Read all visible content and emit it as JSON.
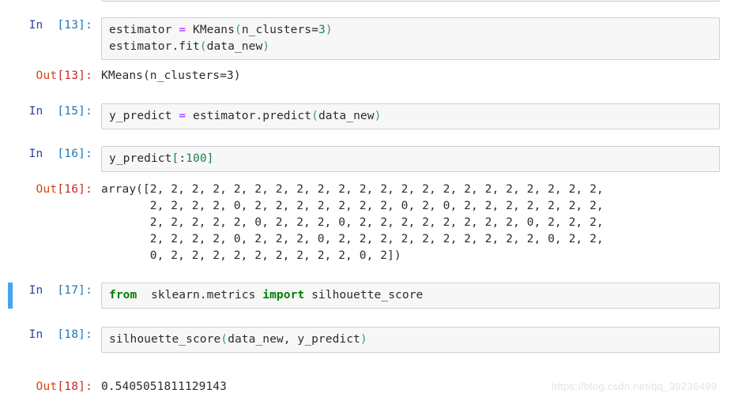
{
  "notebook": {
    "cells": [
      {
        "name": "cell-13",
        "prompt_label": "In",
        "prompt_index": "[13]:",
        "type": "input",
        "selected": false,
        "lines": [
          [
            {
              "t": "estimator ",
              "c": "plain"
            },
            {
              "t": "=",
              "c": "op"
            },
            {
              "t": " KMeans",
              "c": "plain"
            },
            {
              "t": "(",
              "c": "paren"
            },
            {
              "t": "n_clusters",
              "c": "plain"
            },
            {
              "t": "=",
              "c": "plain"
            },
            {
              "t": "3",
              "c": "num"
            },
            {
              "t": ")",
              "c": "paren"
            }
          ],
          [
            {
              "t": "estimator.fit",
              "c": "plain"
            },
            {
              "t": "(",
              "c": "paren"
            },
            {
              "t": "data_new",
              "c": "plain"
            },
            {
              "t": ")",
              "c": "paren"
            }
          ]
        ]
      },
      {
        "name": "cell-out-13",
        "prompt_label": "Out",
        "prompt_index": "[13]:",
        "type": "output",
        "selected": false,
        "lines": [
          [
            {
              "t": "KMeans(n_clusters=3)",
              "c": "outtext"
            }
          ]
        ]
      },
      {
        "name": "cell-15",
        "prompt_label": "In",
        "prompt_index": "[15]:",
        "type": "input",
        "selected": false,
        "lines": [
          [
            {
              "t": "y_predict ",
              "c": "plain"
            },
            {
              "t": "=",
              "c": "op"
            },
            {
              "t": " estimator.predict",
              "c": "plain"
            },
            {
              "t": "(",
              "c": "paren"
            },
            {
              "t": "data_new",
              "c": "plain"
            },
            {
              "t": ")",
              "c": "paren"
            }
          ]
        ]
      },
      {
        "name": "cell-16",
        "prompt_label": "In",
        "prompt_index": "[16]:",
        "type": "input",
        "selected": false,
        "lines": [
          [
            {
              "t": "y_predict",
              "c": "plain"
            },
            {
              "t": "[",
              "c": "brk"
            },
            {
              "t": ":",
              "c": "plain"
            },
            {
              "t": "100",
              "c": "num"
            },
            {
              "t": "]",
              "c": "brk"
            }
          ]
        ]
      },
      {
        "name": "cell-out-16",
        "prompt_label": "Out",
        "prompt_index": "[16]:",
        "type": "output",
        "selected": false,
        "lines": [
          [
            {
              "t": "array([2, 2, 2, 2, 2, 2, 2, 2, 2, 2, 2, 2, 2, 2, 2, 2, 2, 2, 2, 2, 2, 2,",
              "c": "outtext"
            }
          ],
          [
            {
              "t": "       2, 2, 2, 2, 0, 2, 2, 2, 2, 2, 2, 2, 0, 2, 0, 2, 2, 2, 2, 2, 2, 2,",
              "c": "outtext"
            }
          ],
          [
            {
              "t": "       2, 2, 2, 2, 2, 0, 2, 2, 2, 0, 2, 2, 2, 2, 2, 2, 2, 2, 0, 2, 2, 2,",
              "c": "outtext"
            }
          ],
          [
            {
              "t": "       2, 2, 2, 2, 0, 2, 2, 2, 0, 2, 2, 2, 2, 2, 2, 2, 2, 2, 2, 0, 2, 2,",
              "c": "outtext"
            }
          ],
          [
            {
              "t": "       0, 2, 2, 2, 2, 2, 2, 2, 2, 2, 0, 2])",
              "c": "outtext"
            }
          ]
        ]
      },
      {
        "name": "cell-17",
        "prompt_label": "In",
        "prompt_index": "[17]:",
        "type": "input",
        "selected": true,
        "lines": [
          [
            {
              "t": "from",
              "c": "kw"
            },
            {
              "t": "  sklearn.metrics ",
              "c": "plain"
            },
            {
              "t": "import",
              "c": "kw"
            },
            {
              "t": " silhouette_score",
              "c": "plain"
            }
          ]
        ]
      },
      {
        "name": "cell-18",
        "prompt_label": "In",
        "prompt_index": "[18]:",
        "type": "input",
        "selected": false,
        "lines": [
          [
            {
              "t": "silhouette_score",
              "c": "plain"
            },
            {
              "t": "(",
              "c": "paren"
            },
            {
              "t": "data_new, y_predict",
              "c": "plain"
            },
            {
              "t": ")",
              "c": "paren"
            }
          ]
        ]
      },
      {
        "name": "cell-out-18",
        "prompt_label": "Out",
        "prompt_index": "[18]:",
        "type": "output",
        "selected": false,
        "lines": [
          [
            {
              "t": "0.5405051811129143",
              "c": "outtext"
            }
          ]
        ]
      }
    ]
  },
  "watermark": {
    "text": "https://blog.csdn.net/qq_39236499"
  },
  "colors": {
    "cell_background": "#f7f7f7",
    "cell_border": "#cfcfcf",
    "selection_bar": "#42a5f5",
    "in_prompt": "#303f9f",
    "out_prompt": "#d84315",
    "keyword": "#008000",
    "operator": "#aa22ff",
    "number": "#208050"
  },
  "layout": {
    "cell_tops": [
      22,
      86,
      131,
      185,
      230,
      358,
      414,
      480
    ],
    "partial_top_cell": true
  }
}
